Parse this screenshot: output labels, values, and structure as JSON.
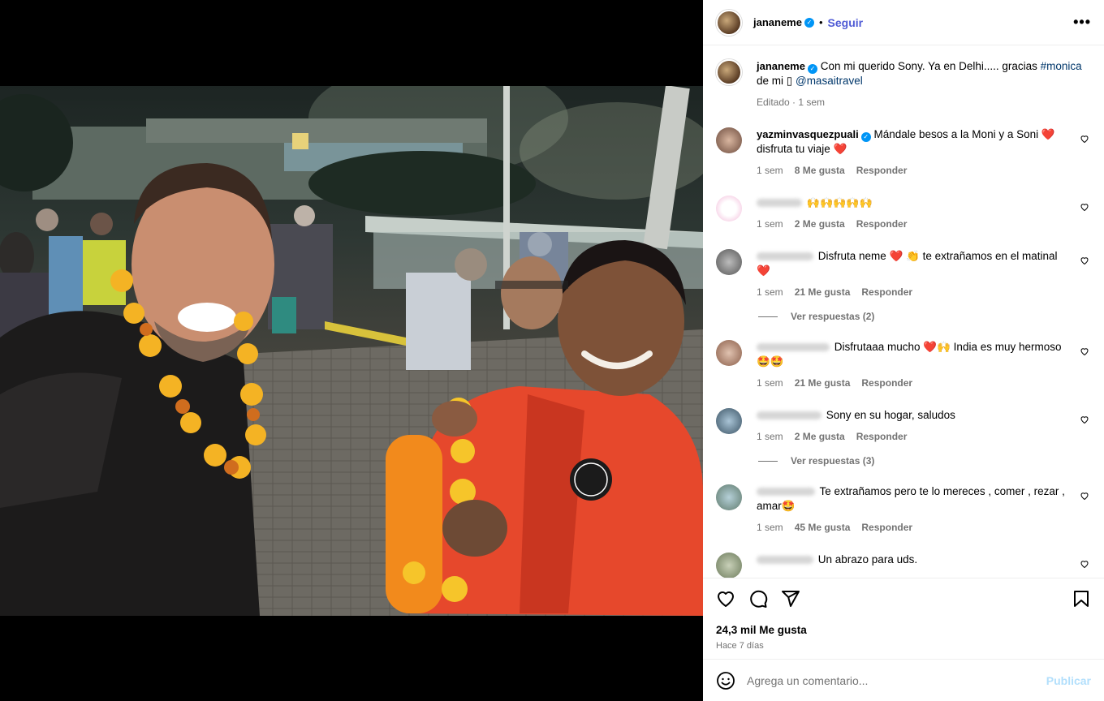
{
  "post": {
    "author": "jananeme",
    "follow_label": "Seguir",
    "caption_pre": "Con mi querido Sony. Ya en Delhi..... gracias",
    "caption_hashtag": "#monica",
    "caption_mid": "de mi",
    "caption_glyph": "▯",
    "caption_mention": "@masaitravel",
    "caption_meta": "Editado · 1 sem",
    "likes": "24,3 mil Me gusta",
    "ago": "Hace 7 días"
  },
  "comments": [
    {
      "user": "yazminvasquezpuali",
      "text": "Mándale besos a la Moni y a Soni ❤️ disfruta tu viaje ❤️",
      "time": "1 sem",
      "likes": "8 Me gusta",
      "reply": "Responder"
    },
    {
      "user": "",
      "text": "🙌🙌🙌🙌🙌",
      "time": "1 sem",
      "likes": "2 Me gusta",
      "reply": "Responder"
    },
    {
      "user": "",
      "text": "Disfruta neme ❤️ 👏 te extrañamos en el matinal ❤️",
      "time": "1 sem",
      "likes": "21 Me gusta",
      "reply": "Responder",
      "view_replies": "Ver respuestas (2)"
    },
    {
      "user": "",
      "text": "Disfrutaaa mucho ❤️🙌 India es muy hermoso 🤩🤩",
      "time": "1 sem",
      "likes": "21 Me gusta",
      "reply": "Responder"
    },
    {
      "user": "",
      "text": "Sony en su hogar, saludos",
      "time": "1 sem",
      "likes": "2 Me gusta",
      "reply": "Responder",
      "view_replies": "Ver respuestas (3)"
    },
    {
      "user": "",
      "text": "Te extrañamos pero te lo mereces , comer , rezar , amar🤩",
      "time": "1 sem",
      "likes": "45 Me gusta",
      "reply": "Responder"
    },
    {
      "user": "",
      "text": "Un abrazo para uds.",
      "time": "",
      "likes": "",
      "reply": ""
    }
  ],
  "composer": {
    "placeholder": "Agrega un comentario...",
    "publish_label": "Publicar"
  },
  "icons": {
    "like": "heart-icon",
    "comment": "comment-icon",
    "share": "share-icon",
    "save": "bookmark-icon",
    "emoji": "emoji-icon",
    "more": "more-options-icon",
    "verified": "verified-badge-icon"
  },
  "colors": {
    "follow": "#4f5bd5",
    "verified": "#0095f6",
    "publish_disabled": "#b2dffc",
    "secondary_text": "#737373",
    "link": "#00376b"
  }
}
